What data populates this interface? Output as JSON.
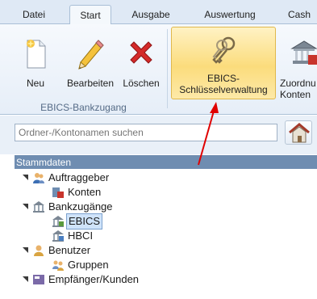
{
  "tabs": [
    "Datei",
    "Start",
    "Ausgabe",
    "Auswertung",
    "Cash"
  ],
  "ribbon": {
    "buttons": {
      "neu": "Neu",
      "bearbeiten": "Bearbeiten",
      "loeschen": "Löschen",
      "ebics_line1": "EBICS-",
      "ebics_line2": "Schlüsselverwaltung",
      "zuord_line1": "Zuordnu",
      "zuord_line2": "Konten"
    },
    "group_label": "EBICS-Bankzugang"
  },
  "search": {
    "placeholder": "Ordner-/Kontonamen suchen"
  },
  "tree": {
    "header": "Stammdaten",
    "nodes": [
      {
        "label": "Auftraggeber",
        "icon": "users-icon"
      },
      {
        "label": "Konten",
        "icon": "accounts-icon"
      },
      {
        "label": "Bankzugänge",
        "icon": "bank-icon"
      },
      {
        "label": "EBICS",
        "icon": "bank-access-icon"
      },
      {
        "label": "HBCI",
        "icon": "bank-access-icon"
      },
      {
        "label": "Benutzer",
        "icon": "user-icon"
      },
      {
        "label": "Gruppen",
        "icon": "group-icon"
      },
      {
        "label": "Empfänger/Kunden",
        "icon": "recipients-icon"
      }
    ]
  },
  "colors": {
    "accent": "#fbdc7c",
    "tree_header": "#6f8db1",
    "annotation_arrow": "#e00000"
  }
}
